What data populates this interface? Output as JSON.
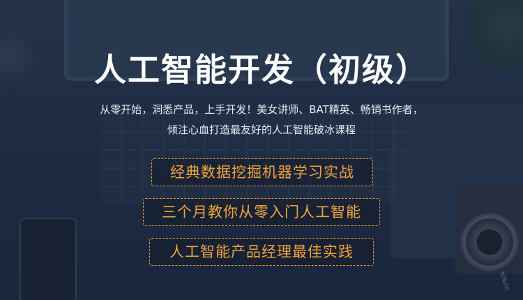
{
  "title": "人工智能开发（初级）",
  "subtitle_lines": [
    "从零开始，洞悉产品，上手开发！美女讲师、BAT精英、畅销书作者，",
    "倾注心血打造最友好的人工智能破冰课程"
  ],
  "highlights": [
    "经典数据挖掘机器学习实战",
    "三个月教你从零入门人工智能",
    "人工智能产品经理最佳实践"
  ],
  "camera_brand": "Nikon",
  "colors": {
    "accent": "#f2a33a",
    "title": "#ffffff",
    "background": "#22304a"
  }
}
